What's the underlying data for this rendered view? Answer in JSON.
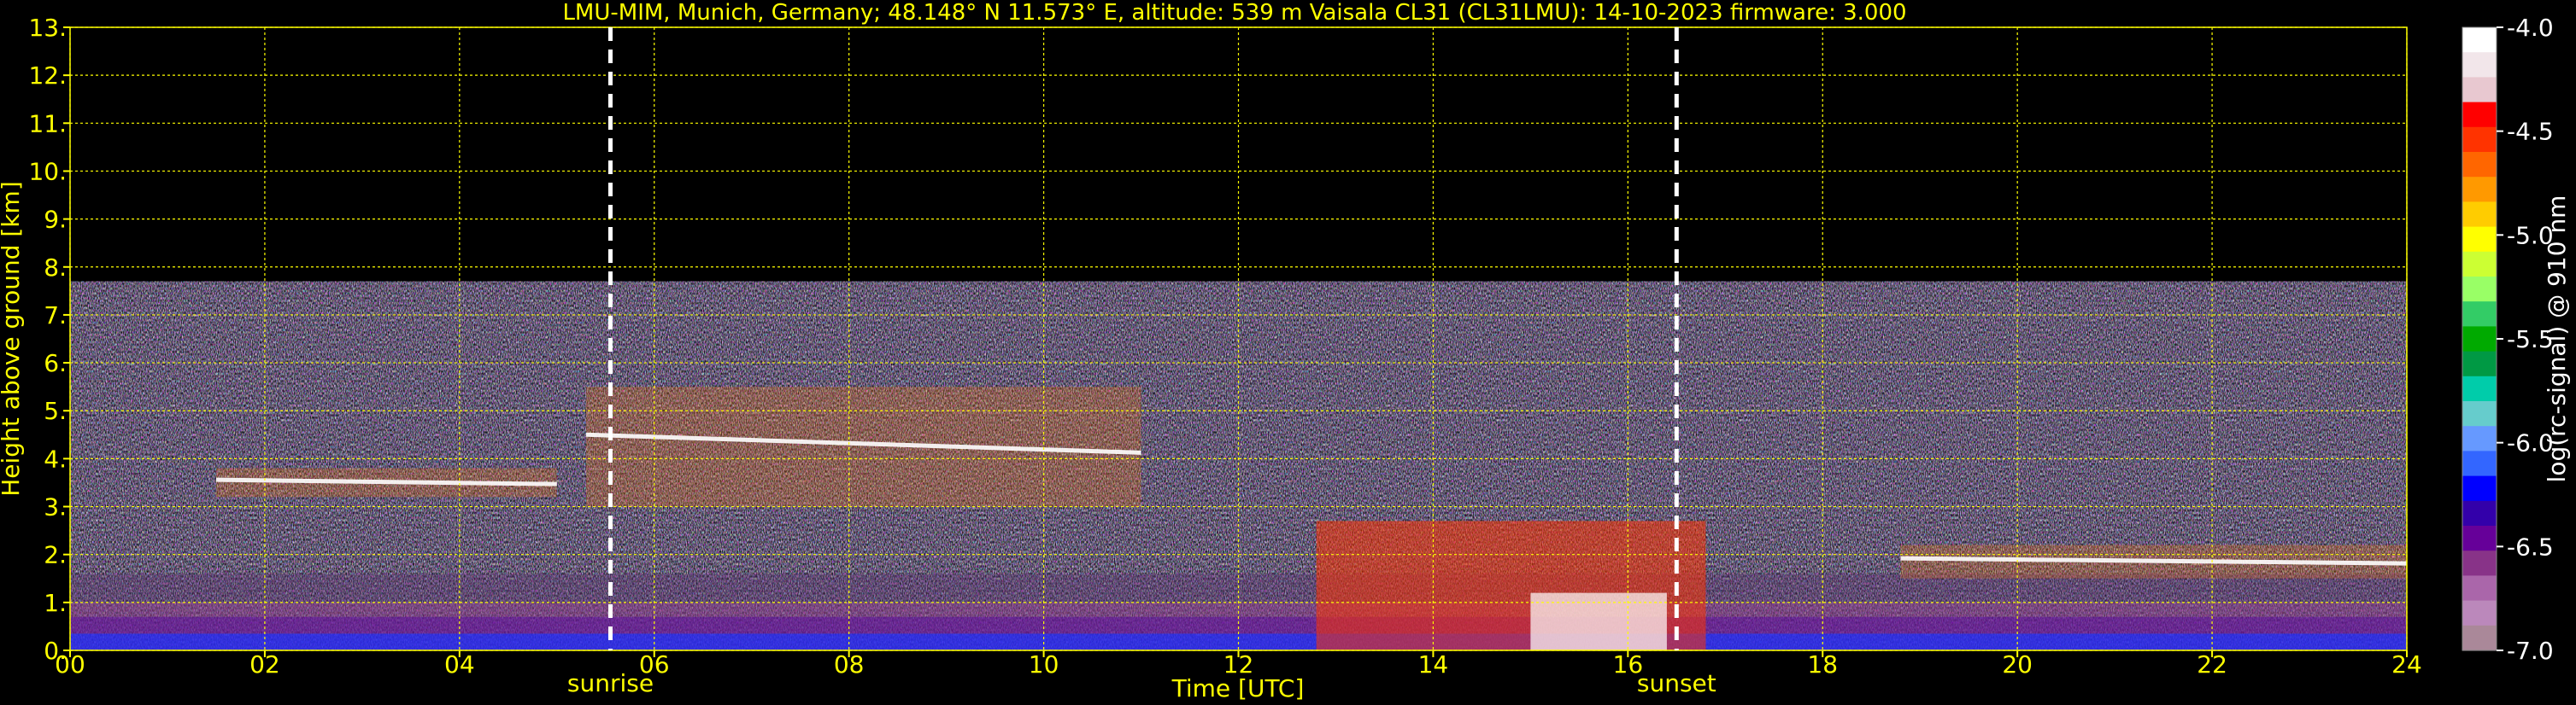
{
  "title": "LMU-MIM, Munich, Germany; 48.148° N 11.573° E, altitude: 539 m    Vaisala CL31 (CL31LMU): 14-10-2023    firmware: 3.000",
  "chart_data": {
    "type": "heatmap",
    "title": "LMU-MIM, Munich, Germany; 48.148° N 11.573° E, altitude: 539 m    Vaisala CL31 (CL31LMU): 14-10-2023    firmware: 3.000",
    "xlabel": "Time [UTC]",
    "ylabel": "Height above ground [km]",
    "xlim": [
      0,
      24
    ],
    "ylim": [
      0,
      13
    ],
    "x_ticks": [
      "00",
      "02",
      "04",
      "06",
      "08",
      "10",
      "12",
      "14",
      "16",
      "18",
      "20",
      "22",
      "24"
    ],
    "y_ticks": [
      "0.",
      "1.",
      "2.",
      "3.",
      "4.",
      "5.",
      "6.",
      "7.",
      "8.",
      "9.",
      "10.",
      "11.",
      "12.",
      "13."
    ],
    "grid": true,
    "colorbar": {
      "label": "log(rc-signal) @ 910 nm",
      "range": [
        -7.0,
        -4.0
      ],
      "ticks": [
        "-4.0",
        "-4.5",
        "-5.0",
        "-5.5",
        "-6.0",
        "-6.5",
        "-7.0"
      ],
      "colors": [
        "#ffffff",
        "#f2e6ea",
        "#e8c8d0",
        "#ff0000",
        "#ff3300",
        "#ff6600",
        "#ff9900",
        "#ffcc00",
        "#ffff00",
        "#ccff33",
        "#99ff66",
        "#33cc66",
        "#00aa00",
        "#009944",
        "#00ccaa",
        "#66cccc",
        "#6699ff",
        "#3366ff",
        "#0000ff",
        "#3300aa",
        "#660099",
        "#883388",
        "#aa66aa",
        "#bb88bb",
        "#aa8899"
      ]
    },
    "annotations": [
      {
        "text": "sunrise",
        "x": 5.55
      },
      {
        "text": "sunset",
        "x": 16.5
      }
    ],
    "data_coverage_top_km": 7.7,
    "features": [
      {
        "name": "cloud layer",
        "x_start": 1.5,
        "x_end": 5.0,
        "height_km": [
          3.2,
          3.8
        ]
      },
      {
        "name": "cloud layer",
        "x_start": 5.3,
        "x_end": 11.0,
        "height_km": [
          3.0,
          5.5
        ]
      },
      {
        "name": "low cloud / precipitation",
        "x_start": 12.8,
        "x_end": 16.8,
        "height_km": [
          0.0,
          2.7
        ]
      },
      {
        "name": "cloud layer",
        "x_start": 18.8,
        "x_end": 24.0,
        "height_km": [
          1.5,
          2.2
        ]
      },
      {
        "name": "boundary layer aerosol",
        "x_start": 0.0,
        "x_end": 24.0,
        "height_km": [
          0.0,
          1.0
        ]
      }
    ]
  }
}
